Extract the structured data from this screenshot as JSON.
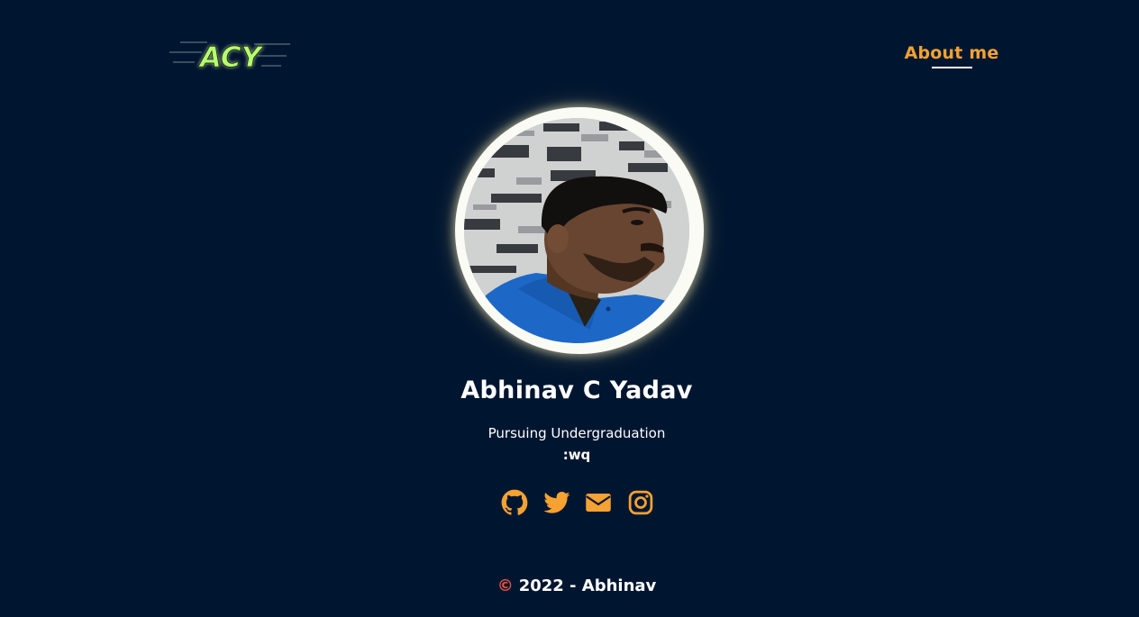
{
  "header": {
    "logo_text": "ACY",
    "nav": [
      {
        "label": "About me",
        "active": true
      }
    ]
  },
  "profile": {
    "name": "Abhinav C Yadav",
    "subtitle": "Pursuing Undergraduation",
    "tagline": ":wq"
  },
  "socials": [
    {
      "icon": "github-icon"
    },
    {
      "icon": "twitter-icon"
    },
    {
      "icon": "envelope-icon"
    },
    {
      "icon": "instagram-icon"
    }
  ],
  "footer": {
    "copyright_symbol": "©",
    "text": "2022 - Abhinav"
  },
  "colors": {
    "background": "#001630",
    "accent": "#f5a233",
    "text": "#ffffff",
    "copyright": "#e8523f",
    "logo_green": "#b8ff70"
  }
}
